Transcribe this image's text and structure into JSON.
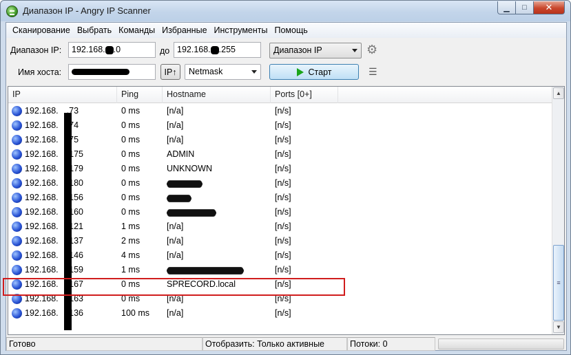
{
  "window": {
    "title": "Диапазон IP - Angry IP Scanner",
    "controls": {
      "minimize": "▁",
      "maximize": "□",
      "close": "✕"
    }
  },
  "menu": [
    "Сканирование",
    "Выбрать",
    "Команды",
    "Избранные",
    "Инструменты",
    "Помощь"
  ],
  "toolbar": {
    "range_label": "Диапазон IP:",
    "from_prefix": "192.168.",
    "from_suffix": ".0",
    "to_label": "до",
    "to_prefix": "192.168.",
    "to_suffix": ".255",
    "mode_select": "Диапазон IP",
    "hostname_label": "Имя хоста:",
    "ip_button": "IP↑",
    "netmask_select": "Netmask",
    "start_button": "Старт"
  },
  "table": {
    "columns": [
      "IP",
      "Ping",
      "Hostname",
      "Ports [0+]"
    ],
    "ip_prefix": "192.168.",
    "rows": [
      {
        "ip_suffix": ".73",
        "ping": "0 ms",
        "hostname": "[n/a]",
        "ports": "[n/s]",
        "hostname_redacted": false
      },
      {
        "ip_suffix": ".74",
        "ping": "0 ms",
        "hostname": "[n/a]",
        "ports": "[n/s]",
        "hostname_redacted": false
      },
      {
        "ip_suffix": ".75",
        "ping": "0 ms",
        "hostname": "[n/a]",
        "ports": "[n/s]",
        "hostname_redacted": false
      },
      {
        "ip_suffix": ".175",
        "ping": "0 ms",
        "hostname": "ADMIN",
        "ports": "[n/s]",
        "hostname_redacted": false
      },
      {
        "ip_suffix": ".179",
        "ping": "0 ms",
        "hostname": "UNKNOWN",
        "ports": "[n/s]",
        "hostname_redacted": false
      },
      {
        "ip_suffix": ".180",
        "ping": "0 ms",
        "hostname": "",
        "ports": "[n/s]",
        "hostname_redacted": true
      },
      {
        "ip_suffix": ".156",
        "ping": "0 ms",
        "hostname": "",
        "ports": "[n/s]",
        "hostname_redacted": true
      },
      {
        "ip_suffix": ".160",
        "ping": "0 ms",
        "hostname": "",
        "ports": "[n/s]",
        "hostname_redacted": true
      },
      {
        "ip_suffix": ".121",
        "ping": "1 ms",
        "hostname": "[n/a]",
        "ports": "[n/s]",
        "hostname_redacted": false
      },
      {
        "ip_suffix": ".137",
        "ping": "2 ms",
        "hostname": "[n/a]",
        "ports": "[n/s]",
        "hostname_redacted": false
      },
      {
        "ip_suffix": ".146",
        "ping": "4 ms",
        "hostname": "[n/a]",
        "ports": "[n/s]",
        "hostname_redacted": false
      },
      {
        "ip_suffix": ".159",
        "ping": "1 ms",
        "hostname": "",
        "ports": "[n/s]",
        "hostname_redacted": true
      },
      {
        "ip_suffix": ".167",
        "ping": "0 ms",
        "hostname": "SPRECORD.local",
        "ports": "[n/s]",
        "hostname_redacted": false
      },
      {
        "ip_suffix": ".163",
        "ping": "0 ms",
        "hostname": "[n/a]",
        "ports": "[n/s]",
        "hostname_redacted": false
      },
      {
        "ip_suffix": ".136",
        "ping": "100 ms",
        "hostname": "[n/a]",
        "ports": "[n/s]",
        "hostname_redacted": false
      }
    ]
  },
  "status": {
    "state": "Готово",
    "display": "Отобразить: Только активные",
    "threads": "Потоки: 0"
  },
  "colors": {
    "highlight": "#d01c1c",
    "start_icon": "#1aa51a",
    "ip_icon": "#2a55d6"
  }
}
